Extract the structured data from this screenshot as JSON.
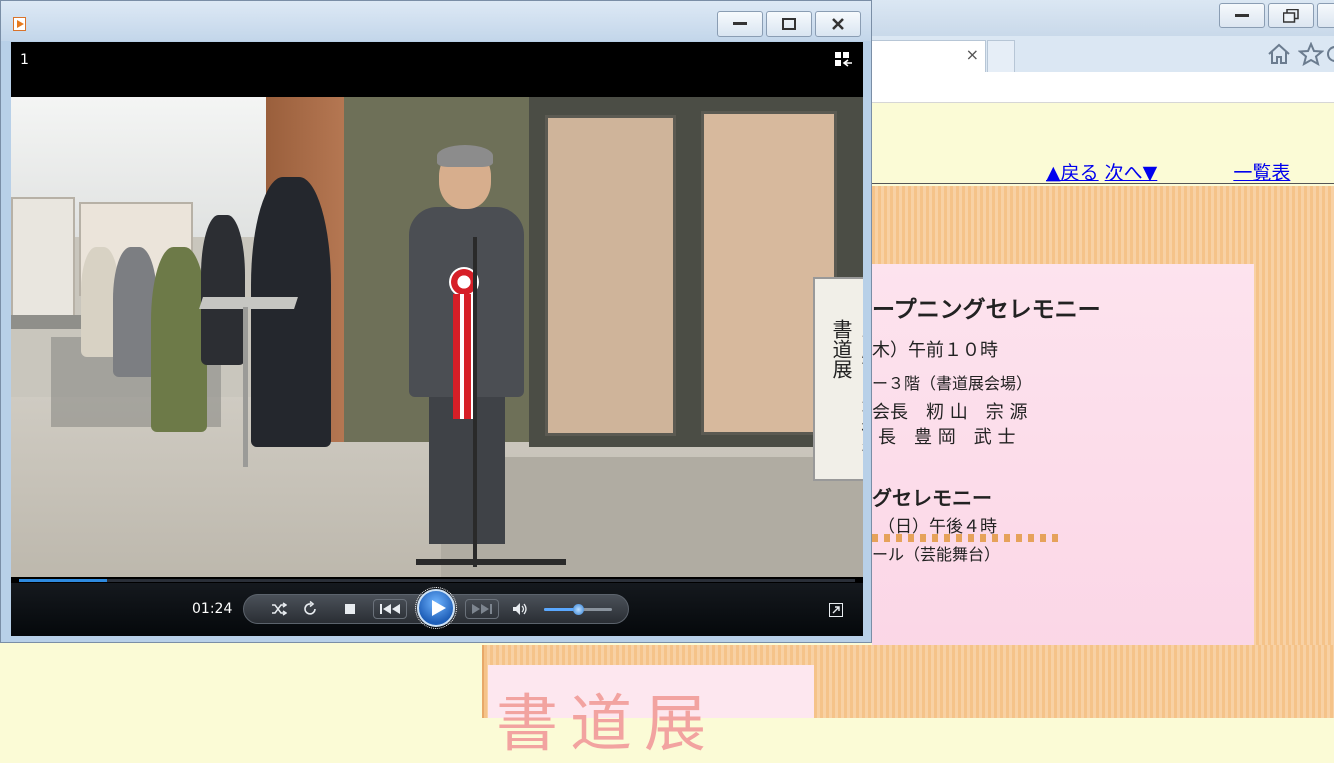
{
  "browser": {
    "tab_close_glyph": "×",
    "nav": {
      "back": "▲戻る",
      "next": "次へ▼",
      "list": "一覧表"
    },
    "poster": {
      "lines": [
        "ープニングセレモニー",
        "木）午前１０時",
        "ー３階（書道展会場）",
        "会長　籾 山　宗 源",
        "長　豊 岡　武 士",
        "グセレモニー",
        "（日）午後４時",
        "ール（芸能舞台）"
      ],
      "big_title": "書道展"
    },
    "colors": {
      "link": "#0000ee",
      "page_bg": "#fbfbd6"
    }
  },
  "player": {
    "track_number": "1",
    "time": "01:24",
    "progress_fraction": 0.105,
    "volume_fraction": 0.5,
    "sign_text": "三鷹市民芸術祭 書道展",
    "icons": {
      "app": "media-player-icon",
      "library": "switch-to-library-icon",
      "shuffle": "shuffle-icon",
      "repeat": "repeat-icon",
      "stop": "stop-icon",
      "previous": "previous-icon",
      "play": "play-icon",
      "next": "next-icon",
      "mute": "volume-icon",
      "fullscreen": "fullscreen-icon"
    },
    "colors": {
      "accent": "#2f8be0",
      "controls_bg": "#0a0d11"
    }
  }
}
